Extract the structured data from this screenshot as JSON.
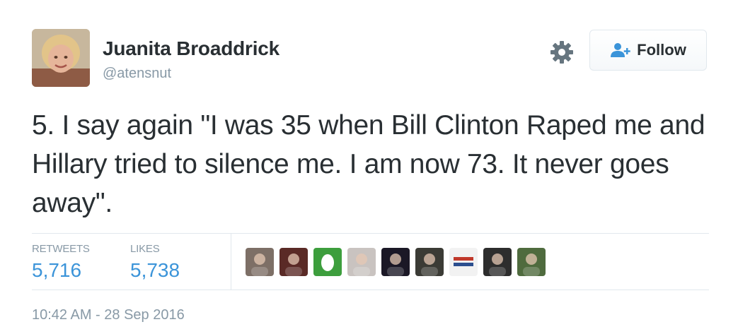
{
  "author": {
    "name": "Juanita Broaddrick",
    "handle": "@atensnut"
  },
  "follow_button": {
    "label": "Follow"
  },
  "tweet": {
    "text": "5. I say again \"I was 35 when Bill Clinton Raped me and Hillary tried to silence me. I am now 73. It never goes away\"."
  },
  "stats": {
    "retweets_label": "RETWEETS",
    "retweets_value": "5,716",
    "likes_label": "LIKES",
    "likes_value": "5,738"
  },
  "timestamp": "10:42 AM - 28 Sep 2016",
  "colors": {
    "link_blue": "#3b94d9",
    "muted_gray": "#8899a6",
    "text": "#292f33",
    "border": "#e1e8ed"
  },
  "liker_avatars": [
    {
      "name": "liker-avatar-1",
      "bg": "#7d6f66"
    },
    {
      "name": "liker-avatar-2",
      "bg": "#5a2a26"
    },
    {
      "name": "liker-avatar-3",
      "bg": "#3d9e3d"
    },
    {
      "name": "liker-avatar-4",
      "bg": "#c9c3c0"
    },
    {
      "name": "liker-avatar-5",
      "bg": "#1b1826"
    },
    {
      "name": "liker-avatar-6",
      "bg": "#3b3b35"
    },
    {
      "name": "liker-avatar-7",
      "bg": "#f2f2f2"
    },
    {
      "name": "liker-avatar-8",
      "bg": "#2d2d2d"
    },
    {
      "name": "liker-avatar-9",
      "bg": "#4f6b3e"
    }
  ]
}
